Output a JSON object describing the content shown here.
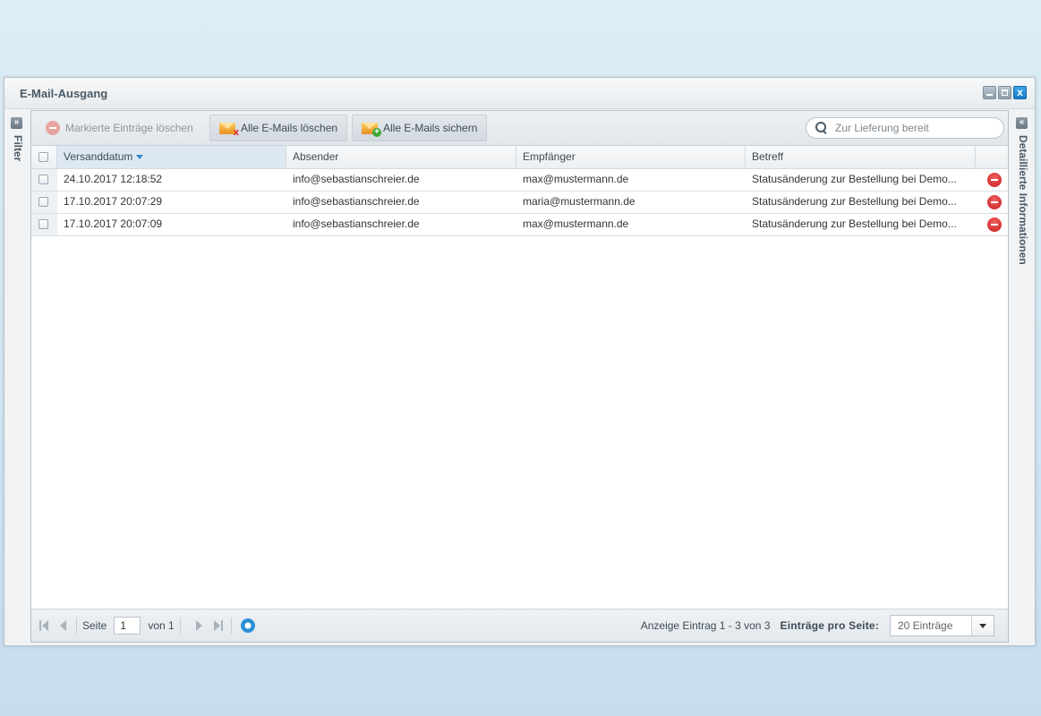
{
  "window": {
    "title": "E-Mail-Ausgang",
    "minimize_icon": "minimize-icon",
    "maximize_icon": "maximize-icon",
    "close_label": "x"
  },
  "side_left": {
    "label": "Filter",
    "toggle": "»"
  },
  "side_right": {
    "label": "Detaillierte Informationen",
    "toggle": "«"
  },
  "toolbar": {
    "delete_marked_label": "Markierte Einträge löschen",
    "delete_all_label": "Alle E-Mails löschen",
    "save_all_label": "Alle E-Mails sichern"
  },
  "search": {
    "placeholder": "Zur Lieferung bereit"
  },
  "table": {
    "columns": [
      "Versanddatum",
      "Absender",
      "Empfänger",
      "Betreff"
    ],
    "sorted_column": "Versanddatum",
    "rows": [
      {
        "date": "24.10.2017 12:18:52",
        "from": "info@sebastianschreier.de",
        "to": "max@mustermann.de",
        "subject": "Statusänderung zur Bestellung bei Demo..."
      },
      {
        "date": "17.10.2017 20:07:29",
        "from": "info@sebastianschreier.de",
        "to": "maria@mustermann.de",
        "subject": "Statusänderung zur Bestellung bei Demo..."
      },
      {
        "date": "17.10.2017 20:07:09",
        "from": "info@sebastianschreier.de",
        "to": "max@mustermann.de",
        "subject": "Statusänderung zur Bestellung bei Demo..."
      }
    ]
  },
  "pager": {
    "page_label": "Seite",
    "page_value": "1",
    "of_label": "von 1",
    "display_info": "Anzeige Eintrag 1 - 3 von 3",
    "per_page_label": "Einträge pro Seite:",
    "per_page_value": "20 Einträge"
  },
  "colors": {
    "accent": "#2a8fd6",
    "delete_red": "#d62828",
    "header_text": "#4b5a66"
  }
}
